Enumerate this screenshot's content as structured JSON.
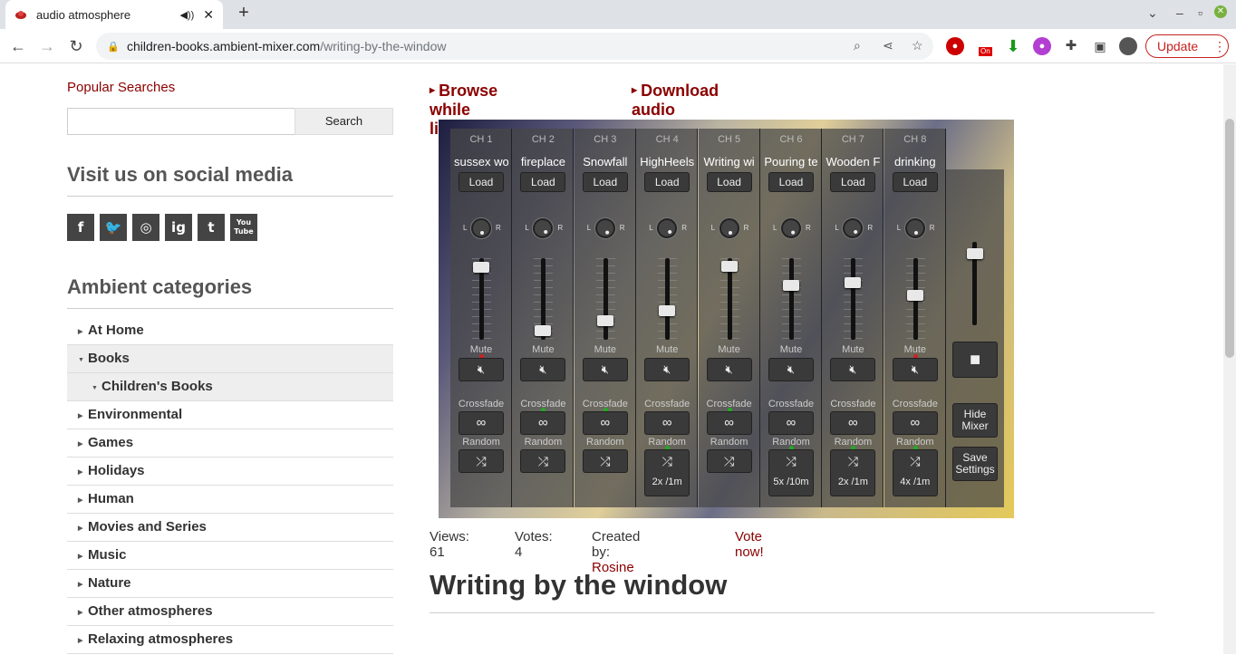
{
  "browser": {
    "tab_title": "audio atmosphere",
    "url_host": "children-books.ambient-mixer.com",
    "url_path": "/writing-by-the-window",
    "update_label": "Update",
    "ext_badge": "On"
  },
  "sidebar": {
    "popular_searches": "Popular Searches",
    "search_placeholder": "",
    "search_button": "Search",
    "social_heading": "Visit us on social media",
    "social_icons": [
      "f",
      "t",
      "ig",
      "p",
      "t",
      "You Tube"
    ],
    "categories_heading": "Ambient categories",
    "categories": [
      {
        "label": "At Home",
        "state": "collapsed"
      },
      {
        "label": "Books",
        "state": "expanded"
      },
      {
        "label": "Children's Books",
        "state": "expanded-child"
      },
      {
        "label": "Environmental",
        "state": "collapsed"
      },
      {
        "label": "Games",
        "state": "collapsed"
      },
      {
        "label": "Holidays",
        "state": "collapsed"
      },
      {
        "label": "Human",
        "state": "collapsed"
      },
      {
        "label": "Movies and Series",
        "state": "collapsed"
      },
      {
        "label": "Music",
        "state": "collapsed"
      },
      {
        "label": "Nature",
        "state": "collapsed"
      },
      {
        "label": "Other atmospheres",
        "state": "collapsed"
      },
      {
        "label": "Relaxing atmospheres",
        "state": "collapsed"
      }
    ]
  },
  "main": {
    "browse_link": "Browse while listening",
    "download_link": "Download audio",
    "mixer": {
      "load_label": "Load",
      "mute_label": "Mute",
      "crossfade_label": "Crossfade",
      "random_label": "Random",
      "channels": [
        {
          "ch": "CH 1",
          "name": "sussex wo",
          "volume": 0.95,
          "pan": 0.5,
          "random_rate": "",
          "mute_led": "#cc2222",
          "cf_led": "",
          "rnd_led": ""
        },
        {
          "ch": "CH 2",
          "name": "fireplace",
          "volume": 0.12,
          "pan": 0.4,
          "random_rate": "",
          "mute_led": "",
          "cf_led": "#22aa22",
          "rnd_led": ""
        },
        {
          "ch": "CH 3",
          "name": "Snowfall",
          "volume": 0.25,
          "pan": 0.45,
          "random_rate": "",
          "mute_led": "",
          "cf_led": "#22aa22",
          "rnd_led": ""
        },
        {
          "ch": "CH 4",
          "name": "HighHeels",
          "volume": 0.38,
          "pan": 0.4,
          "random_rate": "2x /1m",
          "mute_led": "",
          "cf_led": "",
          "rnd_led": "#22aa22"
        },
        {
          "ch": "CH 5",
          "name": "Writing wi",
          "volume": 0.97,
          "pan": 0.5,
          "random_rate": "",
          "mute_led": "",
          "cf_led": "#22aa22",
          "rnd_led": ""
        },
        {
          "ch": "CH 6",
          "name": "Pouring te",
          "volume": 0.72,
          "pan": 0.45,
          "random_rate": "5x /10m",
          "mute_led": "",
          "cf_led": "",
          "rnd_led": "#22aa22"
        },
        {
          "ch": "CH 7",
          "name": "Wooden F",
          "volume": 0.75,
          "pan": 0.4,
          "random_rate": "2x /1m",
          "mute_led": "",
          "cf_led": "",
          "rnd_led": "#22aa22"
        },
        {
          "ch": "CH 8",
          "name": "drinking",
          "volume": 0.58,
          "pan": 0.5,
          "random_rate": "4x /1m",
          "mute_led": "#cc2222",
          "cf_led": "",
          "rnd_led": "#22aa22"
        }
      ],
      "master_volume": 0.92,
      "hide_mixer": "Hide Mixer",
      "save_settings": "Save Settings"
    },
    "stats": {
      "views": "Views: 61",
      "votes": "Votes: 4",
      "created_by_label": "Created by:",
      "creator": "Rosine",
      "vote_now": "Vote now!"
    },
    "page_title": "Writing by the window"
  }
}
